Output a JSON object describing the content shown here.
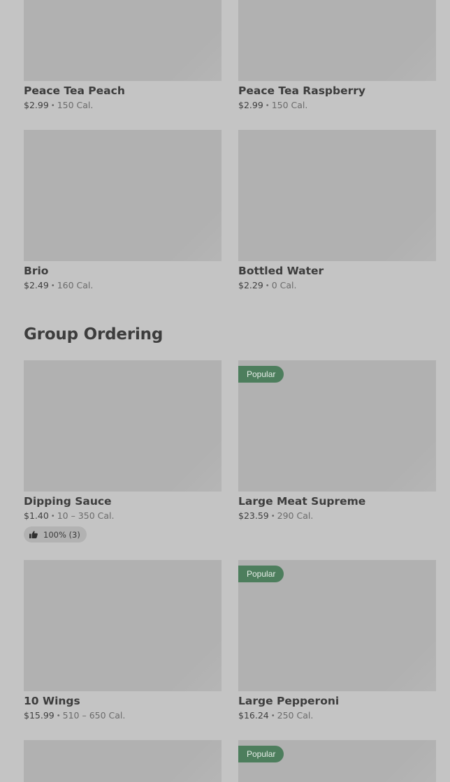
{
  "sections": [
    {
      "items": [
        {
          "name": "Peace Tea Peach",
          "price": "$2.99",
          "calories": "150 Cal."
        },
        {
          "name": "Peace Tea Raspberry",
          "price": "$2.99",
          "calories": "150 Cal."
        },
        {
          "name": "Brio",
          "price": "$2.49",
          "calories": "160 Cal."
        },
        {
          "name": "Bottled Water",
          "price": "$2.29",
          "calories": "0 Cal."
        }
      ]
    },
    {
      "title": "Group Ordering",
      "items": [
        {
          "name": "Dipping Sauce",
          "price": "$1.40",
          "calories": "10 – 350 Cal.",
          "rating": "100% (3)"
        },
        {
          "name": "Large Meat Supreme",
          "price": "$23.59",
          "calories": "290 Cal.",
          "badge": "Popular"
        },
        {
          "name": "10 Wings",
          "price": "$15.99",
          "calories": "510 – 650 Cal."
        },
        {
          "name": "Large Pepperoni",
          "price": "$16.24",
          "calories": "250 Cal.",
          "badge": "Popular"
        },
        {
          "badge": null
        },
        {
          "badge": "Popular"
        }
      ]
    }
  ],
  "separator": "•",
  "icons": {
    "rating": "thumbs-up-icon"
  },
  "colors": {
    "badge": "#4d7e5d",
    "background": "#c4c4c4",
    "placeholder": "#b1b1b1"
  }
}
